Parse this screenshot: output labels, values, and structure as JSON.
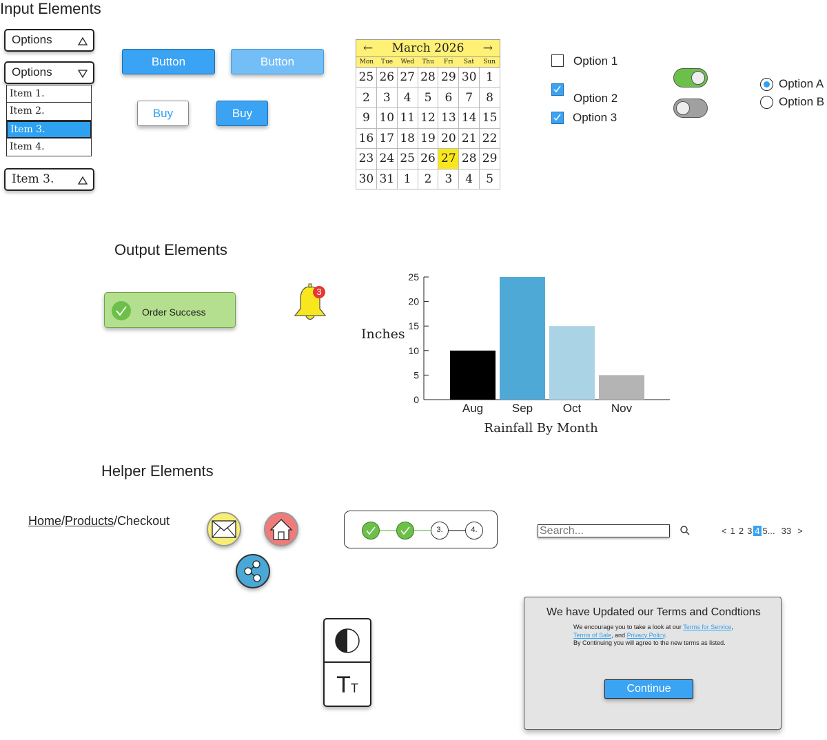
{
  "sections": {
    "input": "Input Elements",
    "output": "Output Elements",
    "helper": "Helper Elements"
  },
  "dropdowns": {
    "closed_label": "Options",
    "open_label": "Options",
    "items": [
      "Item 1.",
      "Item 2.",
      "Item 3.",
      "Item 4."
    ],
    "selected_index": 2,
    "selected_label": "Item 3."
  },
  "buttons": {
    "primary": "Button",
    "light": "Button",
    "buy_outline": "Buy",
    "buy_filled": "Buy"
  },
  "calendar": {
    "prev": "←",
    "next": "→",
    "title": "March 2026",
    "weekdays": [
      "Mon",
      "Tue",
      "Wed",
      "Thu",
      "Fri",
      "Sat",
      "Sun"
    ],
    "days": [
      25,
      26,
      27,
      28,
      29,
      30,
      1,
      2,
      3,
      4,
      5,
      6,
      7,
      8,
      9,
      10,
      11,
      12,
      13,
      14,
      15,
      16,
      17,
      18,
      19,
      20,
      21,
      22,
      23,
      24,
      25,
      26,
      27,
      28,
      29,
      30,
      31,
      1,
      2,
      3,
      4,
      5
    ],
    "highlight_index": 32
  },
  "checkboxes": [
    {
      "label": "Option 1",
      "checked": false
    },
    {
      "label": "Option 2",
      "checked": true
    },
    {
      "label": "Option 3",
      "checked": true
    }
  ],
  "toggles": [
    {
      "on": true,
      "color": "#6cc04a"
    },
    {
      "on": false,
      "color": "#a0a0a0"
    }
  ],
  "radios": [
    {
      "label": "Option A",
      "selected": true
    },
    {
      "label": "Option B",
      "selected": false
    }
  ],
  "notification": {
    "success_text": "Order Success",
    "bell_count": "3"
  },
  "chart_data": {
    "type": "bar",
    "categories": [
      "Aug",
      "Sep",
      "Oct",
      "Nov"
    ],
    "values": [
      10,
      25,
      15,
      5
    ],
    "colors": [
      "#000000",
      "#4fa9d6",
      "#abd3e6",
      "#b4b4b4"
    ],
    "title": "",
    "xlabel": "Rainfall By Month",
    "ylabel": "Inches",
    "ylim": [
      0,
      25
    ],
    "yticks": [
      0,
      5,
      10,
      15,
      20,
      25
    ],
    "grid": false
  },
  "breadcrumb": {
    "home": "Home",
    "products": "Products",
    "current": "Checkout",
    "separator": "/"
  },
  "icon_buttons": [
    {
      "icon": "mail-icon",
      "color": "#f8ee73"
    },
    {
      "icon": "home-icon",
      "color": "#ef7b7b"
    },
    {
      "icon": "share-icon",
      "color": "#4aa8d6"
    }
  ],
  "stepper": {
    "steps": [
      "",
      "",
      "3.",
      "4."
    ],
    "completed": 2,
    "accent": "#6cc04a"
  },
  "search": {
    "placeholder": "Search..."
  },
  "pagination": {
    "prev": "<",
    "pages": [
      "1",
      "2",
      "3",
      "4",
      "5"
    ],
    "current": "4",
    "ellipsis": "...",
    "last": "33",
    "next": ">"
  },
  "accessibility": {
    "contrast_icon": "contrast-icon",
    "text_size_big": "T",
    "text_size_small": "T"
  },
  "modal": {
    "title": "We have Updated our Terms and Condtions",
    "line1_prefix": "We encourage you to take a look at our ",
    "link_terms_service": "Terms for Service",
    "comma": ",",
    "link_terms_sale": "Terms of Sale",
    "and_text": ", and ",
    "link_privacy": "Privacy Policy",
    "period": ".",
    "line3": "By Continuing you will agree to the new terms as listed.",
    "continue": "Continue"
  }
}
